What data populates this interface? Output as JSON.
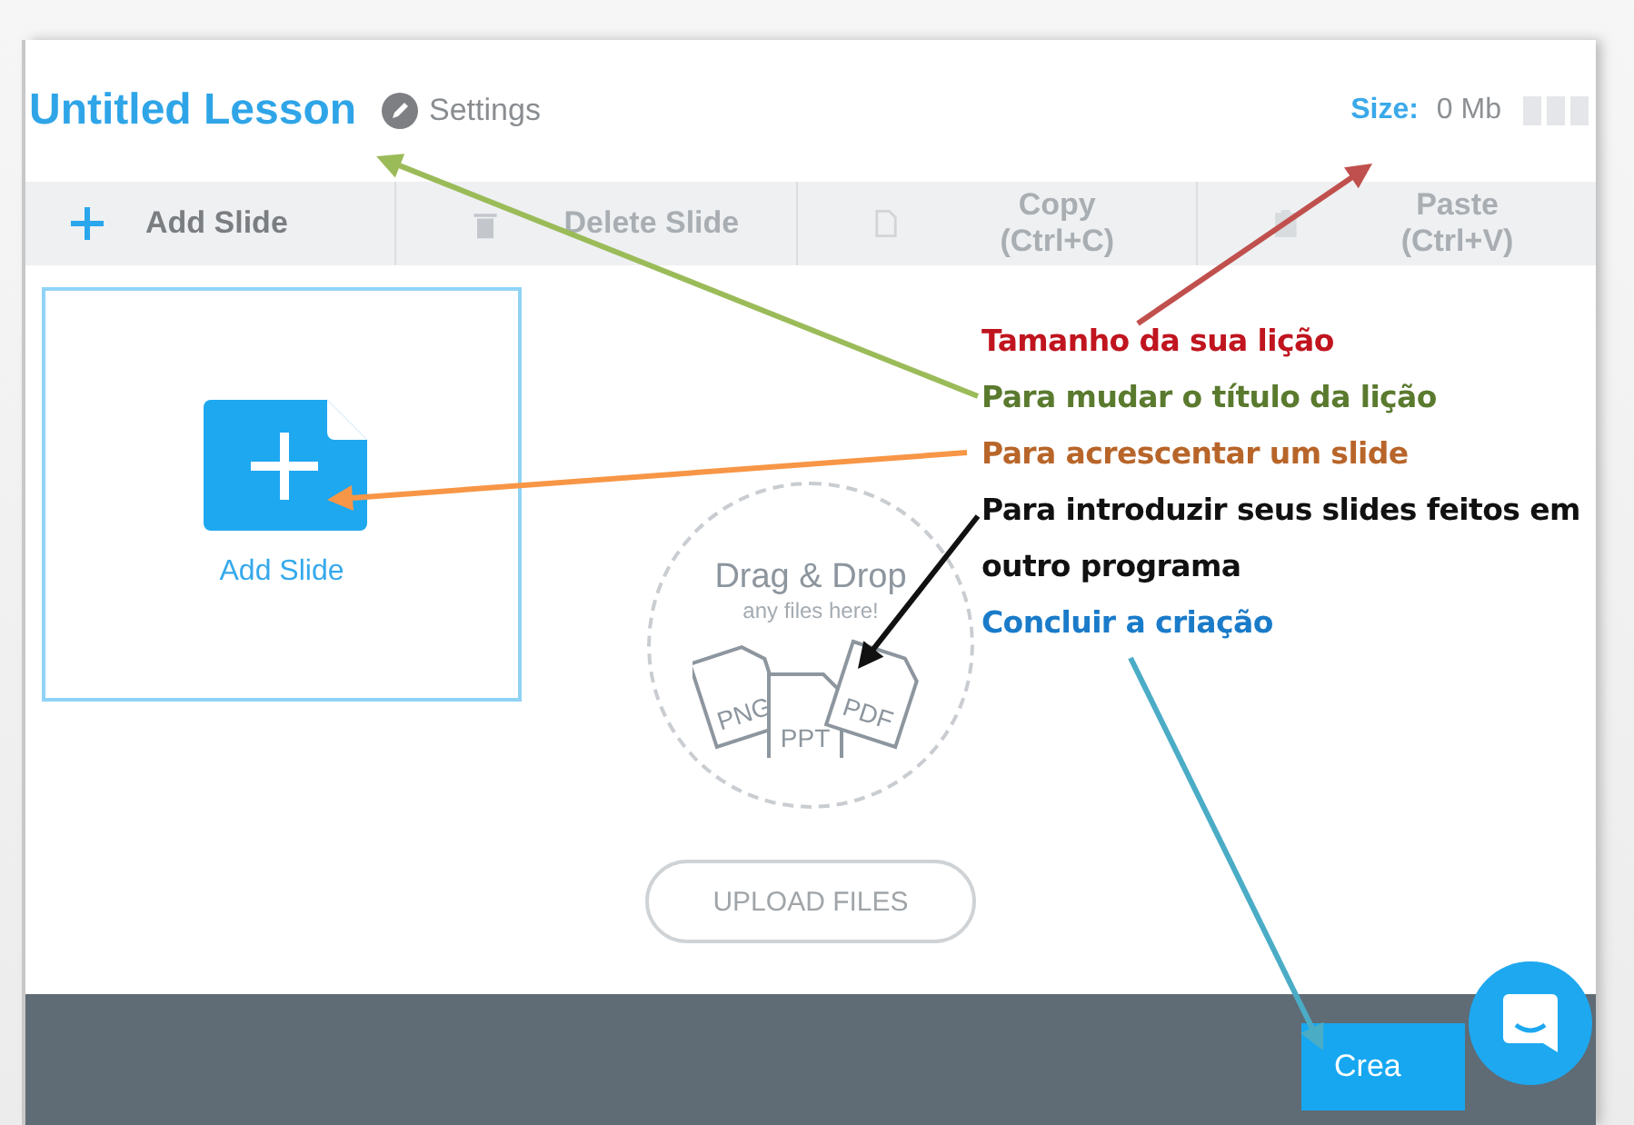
{
  "header": {
    "title": "Untitled Lesson",
    "settings_label": "Settings",
    "size_label": "Size:",
    "size_value": "0 Mb"
  },
  "toolbar": [
    {
      "kind": "add",
      "label": "Add Slide",
      "disabled": false
    },
    {
      "kind": "delete",
      "label": "Delete Slide",
      "disabled": true
    },
    {
      "kind": "copy",
      "label": "Copy (Ctrl+C)",
      "disabled": true
    },
    {
      "kind": "paste",
      "label": "Paste (Ctrl+V)",
      "disabled": true
    }
  ],
  "slide_card": {
    "label": "Add Slide"
  },
  "drop_zone": {
    "title": "Drag & Drop",
    "subtitle": "any files here!",
    "file_types": [
      "PNG",
      "PPT",
      "PDF"
    ],
    "button": "UPLOAD FILES"
  },
  "footer": {
    "create_button": "Crea"
  },
  "annotations": [
    {
      "text": "Tamanho da sua lição",
      "color": "#c0151f"
    },
    {
      "text": "Para mudar o título da lição",
      "color": "#5a7a2e"
    },
    {
      "text": "Para acrescentar um slide",
      "color": "#b8652a"
    },
    {
      "text": "Para introduzir seus slides feitos em outro programa",
      "color": "#111111"
    },
    {
      "text": "Concluir a criação",
      "color": "#1a7bc9"
    }
  ]
}
